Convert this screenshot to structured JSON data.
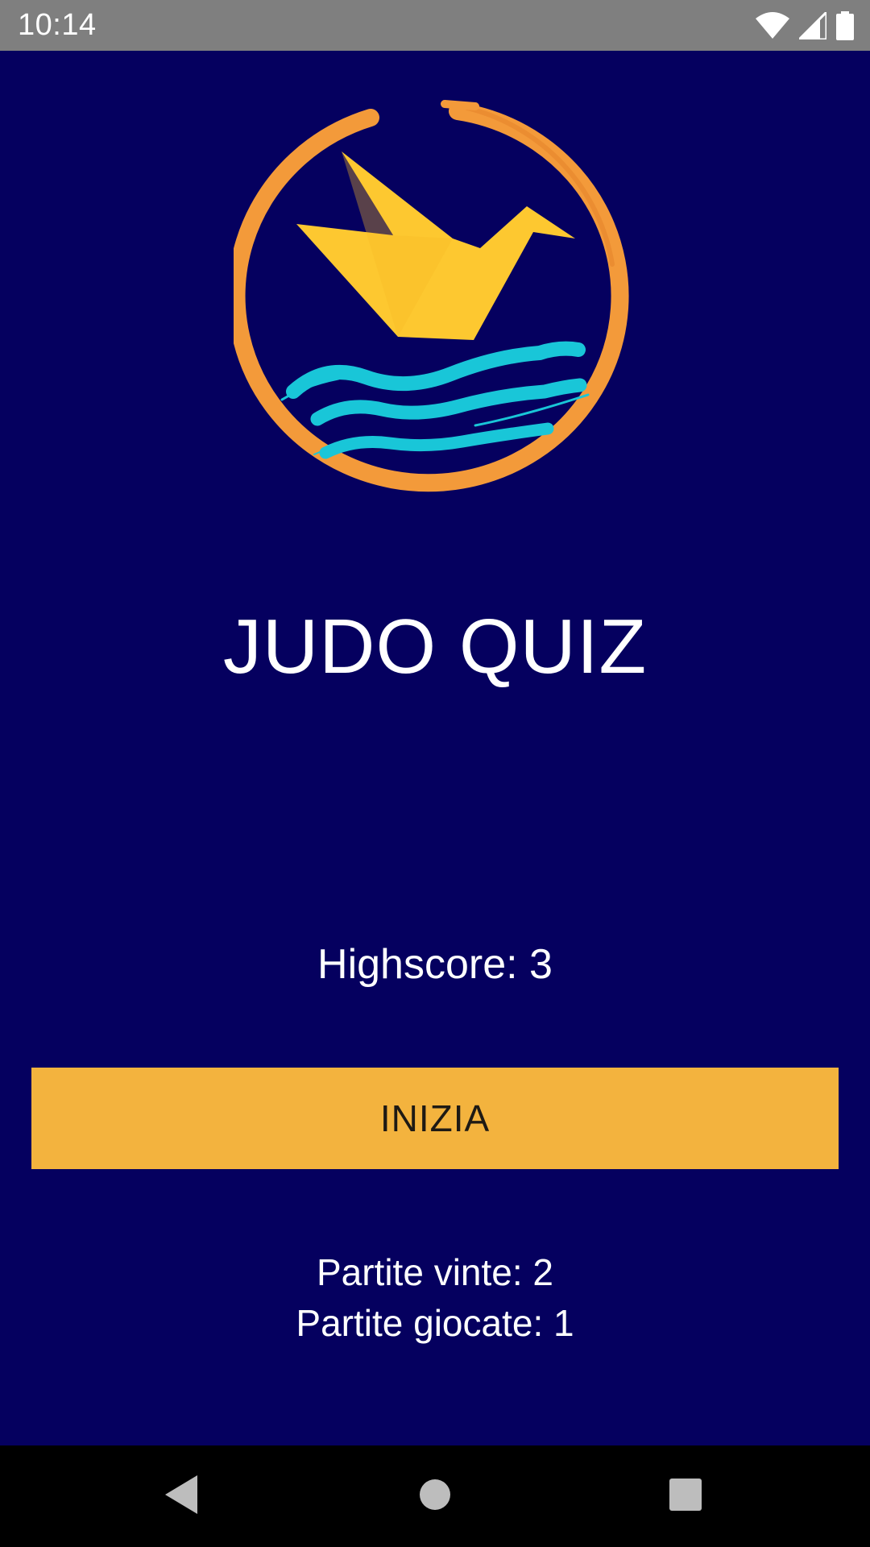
{
  "status_bar": {
    "time": "10:14",
    "icons": [
      "wifi-icon",
      "cell-signal-icon",
      "battery-icon"
    ]
  },
  "logo": {
    "icon": "paper-crane-waves-logo",
    "colors": {
      "ring": "#f39a3a",
      "crane": "#fdc830",
      "waves": "#19c6d8"
    }
  },
  "main": {
    "title": "JUDO QUIZ",
    "highscore": "Highscore: 3",
    "start_button": "INIZIA",
    "games_won": "Partite vinte: 2",
    "games_played": "Partite giocate: 1"
  },
  "nav_bar": {
    "icons": [
      "back-icon",
      "home-icon",
      "recent-apps-icon"
    ]
  },
  "colors": {
    "background": "#05005f",
    "button": "#f3b33e",
    "status_bar": "#7f7f7f",
    "nav_bar": "#000000",
    "text": "#ffffff"
  }
}
